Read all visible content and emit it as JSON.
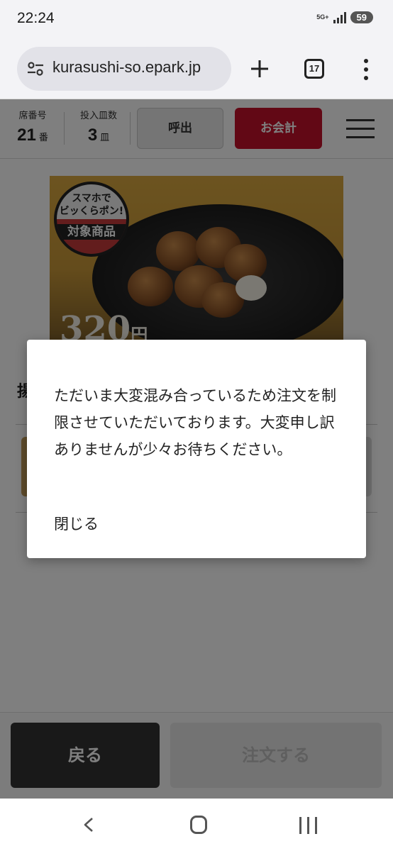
{
  "status_bar": {
    "time": "22:24",
    "network_label": "5G+",
    "battery": "59"
  },
  "browser": {
    "url": "kurasushi-so.epark.jp",
    "tab_count": "17",
    "icons": [
      "tune-icon",
      "plus-icon",
      "tabs-icon",
      "more-vert-icon"
    ]
  },
  "header": {
    "seat_label": "席番号",
    "seat_number": "21",
    "seat_unit": "番",
    "plates_label": "投入皿数",
    "plates_count": "3",
    "plates_unit": "皿",
    "call_button": "呼出",
    "checkout_button": "お会計",
    "colors": {
      "checkout": "#c4102a"
    }
  },
  "product": {
    "badge_lines": [
      "スマホで",
      "ビッくらポン!",
      "対象商品"
    ],
    "price": "320",
    "price_unit": "円",
    "section_heading": "揚"
  },
  "dialog": {
    "message": "ただいま大変混み合っているため注文を制限させていただいております。大変申し訳ありませんが少々お待ちください。",
    "close_label": "閉じる"
  },
  "bottom_bar": {
    "back_button": "戻る",
    "order_button": "注文する"
  },
  "nav_bar": {
    "icons": [
      "back-icon",
      "home-icon",
      "recents-icon"
    ]
  }
}
